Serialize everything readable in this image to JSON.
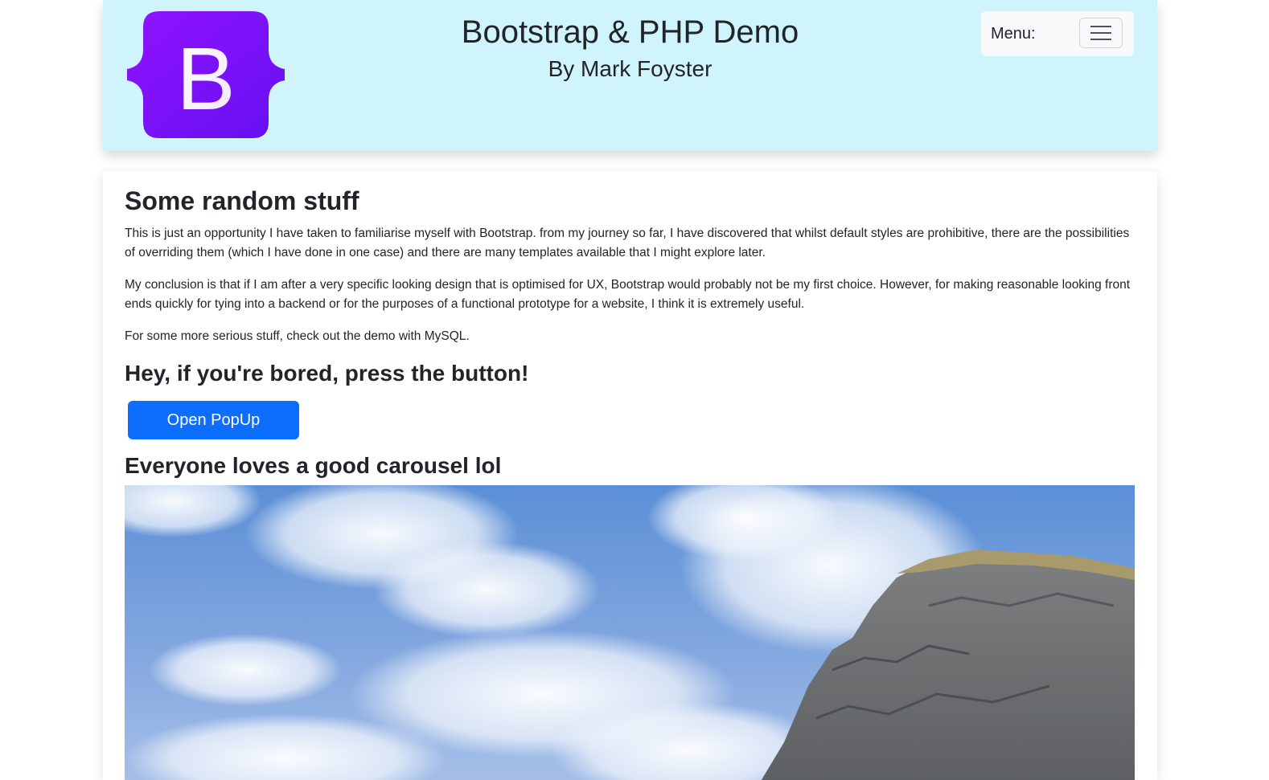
{
  "header": {
    "logo_letter": "B",
    "title": "Bootstrap & PHP Demo",
    "subtitle": "By Mark Foyster",
    "menu_label": "Menu:",
    "brand_color": "#7f13fc",
    "background_color": "#cff4fc"
  },
  "main": {
    "heading": "Some random stuff",
    "paragraphs": [
      "This is just an opportunity I have taken to familiarise myself with Bootstrap. from my journey so far, I have discovered that whilst default styles are prohibitive, there are the possibilities of overriding them (which I have done in one case) and there are many templates available that I might explore later.",
      "My conclusion is that if I am after a very specific looking design that is optimised for UX, Bootstrap would probably not be my first choice. However, for making reasonable looking front ends quickly for tying into a backend or for the purposes of a functional prototype for a website, I think it is extremely useful.",
      "For some more serious stuff, check out the demo with MySQL."
    ],
    "popup_heading": "Hey, if you're bored, press the button!",
    "popup_button_label": "Open PopUp",
    "popup_button_color": "#0d6efd",
    "carousel_heading": "Everyone loves a good carousel lol",
    "carousel_image": "landscape-photo-icon"
  }
}
